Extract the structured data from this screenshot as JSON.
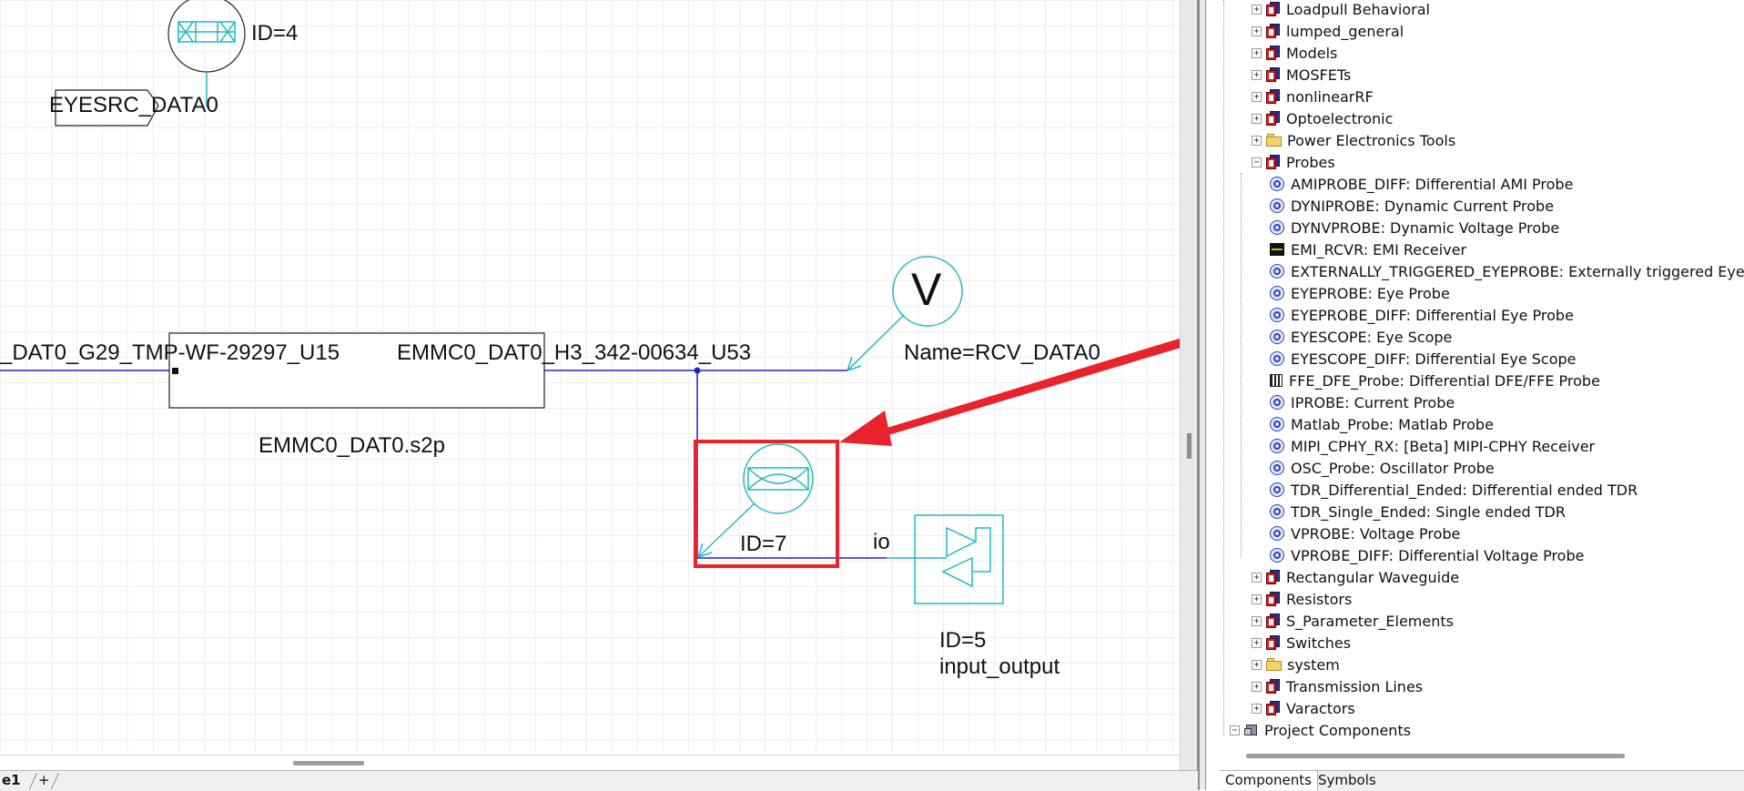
{
  "schematic": {
    "source": {
      "id_label": "ID=4",
      "port_label": "EYESRC_DATA0"
    },
    "net_left": "_DAT0_G29_TMP-WF-29297_U15",
    "net_right": "EMMC0_DAT0_H3_342-00634_U53",
    "sparam_file": "EMMC0_DAT0.s2p",
    "receiver": {
      "symbol_letter": "V",
      "name_label": "Name=RCV_DATA0"
    },
    "eye_probe": {
      "id_label": "ID=7"
    },
    "io_port": {
      "io_label": "io",
      "id_label": "ID=5",
      "type_label": "input_output"
    }
  },
  "tree": {
    "libraries": [
      {
        "label": "Loadpull Behavioral",
        "icon": "library-icon",
        "expander": "+"
      },
      {
        "label": "lumped_general",
        "icon": "library-icon",
        "expander": "+"
      },
      {
        "label": "Models",
        "icon": "library-icon",
        "expander": "+"
      },
      {
        "label": "MOSFETs",
        "icon": "library-icon",
        "expander": "+"
      },
      {
        "label": "nonlinearRF",
        "icon": "library-icon",
        "expander": "+"
      },
      {
        "label": "Optoelectronic",
        "icon": "library-icon",
        "expander": "+"
      },
      {
        "label": "Power Electronics Tools",
        "icon": "folder-icon",
        "expander": "+"
      },
      {
        "label": "Probes",
        "icon": "library-icon",
        "expander": "−"
      }
    ],
    "probes": [
      {
        "label": "AMIPROBE_DIFF: Differential AMI Probe",
        "icon": "probe-icon"
      },
      {
        "label": "DYNIPROBE: Dynamic Current Probe",
        "icon": "probe-icon"
      },
      {
        "label": "DYNVPROBE: Dynamic Voltage Probe",
        "icon": "probe-icon"
      },
      {
        "label": "EMI_RCVR: EMI Receiver",
        "icon": "emi-receiver-icon"
      },
      {
        "label": "EXTERNALLY_TRIGGERED_EYEPROBE: Externally triggered Eye P",
        "icon": "probe-icon"
      },
      {
        "label": "EYEPROBE: Eye Probe",
        "icon": "probe-icon"
      },
      {
        "label": "EYEPROBE_DIFF: Differential Eye Probe",
        "icon": "probe-icon"
      },
      {
        "label": "EYESCOPE: Eye Scope",
        "icon": "probe-icon"
      },
      {
        "label": "EYESCOPE_DIFF: Differential Eye Scope",
        "icon": "probe-icon"
      },
      {
        "label": "FFE_DFE_Probe: Differential DFE/FFE Probe",
        "icon": "ffe-probe-icon"
      },
      {
        "label": "IPROBE: Current Probe",
        "icon": "probe-icon"
      },
      {
        "label": "Matlab_Probe: Matlab Probe",
        "icon": "probe-icon"
      },
      {
        "label": "MIPI_CPHY_RX: [Beta] MIPI-CPHY Receiver",
        "icon": "probe-icon"
      },
      {
        "label": "OSC_Probe: Oscillator Probe",
        "icon": "probe-icon"
      },
      {
        "label": "TDR_Differential_Ended: Differential ended TDR",
        "icon": "probe-icon"
      },
      {
        "label": "TDR_Single_Ended: Single ended TDR",
        "icon": "probe-icon"
      },
      {
        "label": "VPROBE: Voltage Probe",
        "icon": "probe-icon"
      },
      {
        "label": "VPROBE_DIFF: Differential Voltage Probe",
        "icon": "probe-icon"
      }
    ],
    "more_libraries": [
      {
        "label": "Rectangular Waveguide",
        "icon": "library-icon",
        "expander": "+"
      },
      {
        "label": "Resistors",
        "icon": "library-icon",
        "expander": "+"
      },
      {
        "label": "S_Parameter_Elements",
        "icon": "library-icon",
        "expander": "+"
      },
      {
        "label": "Switches",
        "icon": "library-icon",
        "expander": "+"
      },
      {
        "label": "system",
        "icon": "folder-icon",
        "expander": "+"
      },
      {
        "label": "Transmission Lines",
        "icon": "library-icon",
        "expander": "+"
      },
      {
        "label": "Varactors",
        "icon": "library-icon",
        "expander": "+"
      }
    ],
    "project_components": {
      "label": "Project Components",
      "icon": "project-icon",
      "expander": "−"
    }
  },
  "tabs": {
    "sheet_tab": "e1",
    "add_tab": "+",
    "components_tab": "Components",
    "symbols_tab": "Symbols"
  },
  "colors": {
    "wire": "#2323c8",
    "symbol": "#22b8c4",
    "highlight": "#e8232c"
  }
}
